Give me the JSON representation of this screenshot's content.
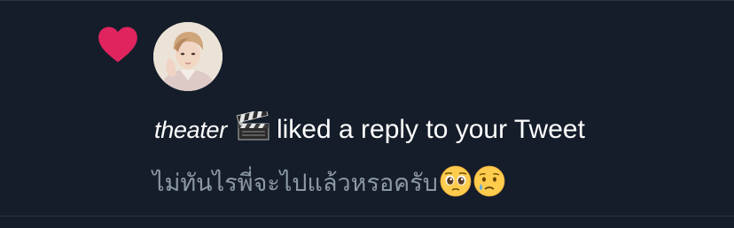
{
  "notification": {
    "type_icon": "heart-icon",
    "avatar": "user-avatar",
    "user_name": "theater",
    "user_name_icon": "clapper-board-icon",
    "action_text": "liked a reply to your Tweet",
    "reply_text": "ไม่ทันไรพี่จะไปแล้วหรอครับ",
    "reply_emojis": [
      "pleading-face-icon",
      "crying-face-icon"
    ],
    "colors": {
      "background": "#151d2a",
      "heart": "#e0245e",
      "primary_text": "#ffffff",
      "secondary_text": "#8b98a5",
      "divider": "#2c3645"
    }
  }
}
